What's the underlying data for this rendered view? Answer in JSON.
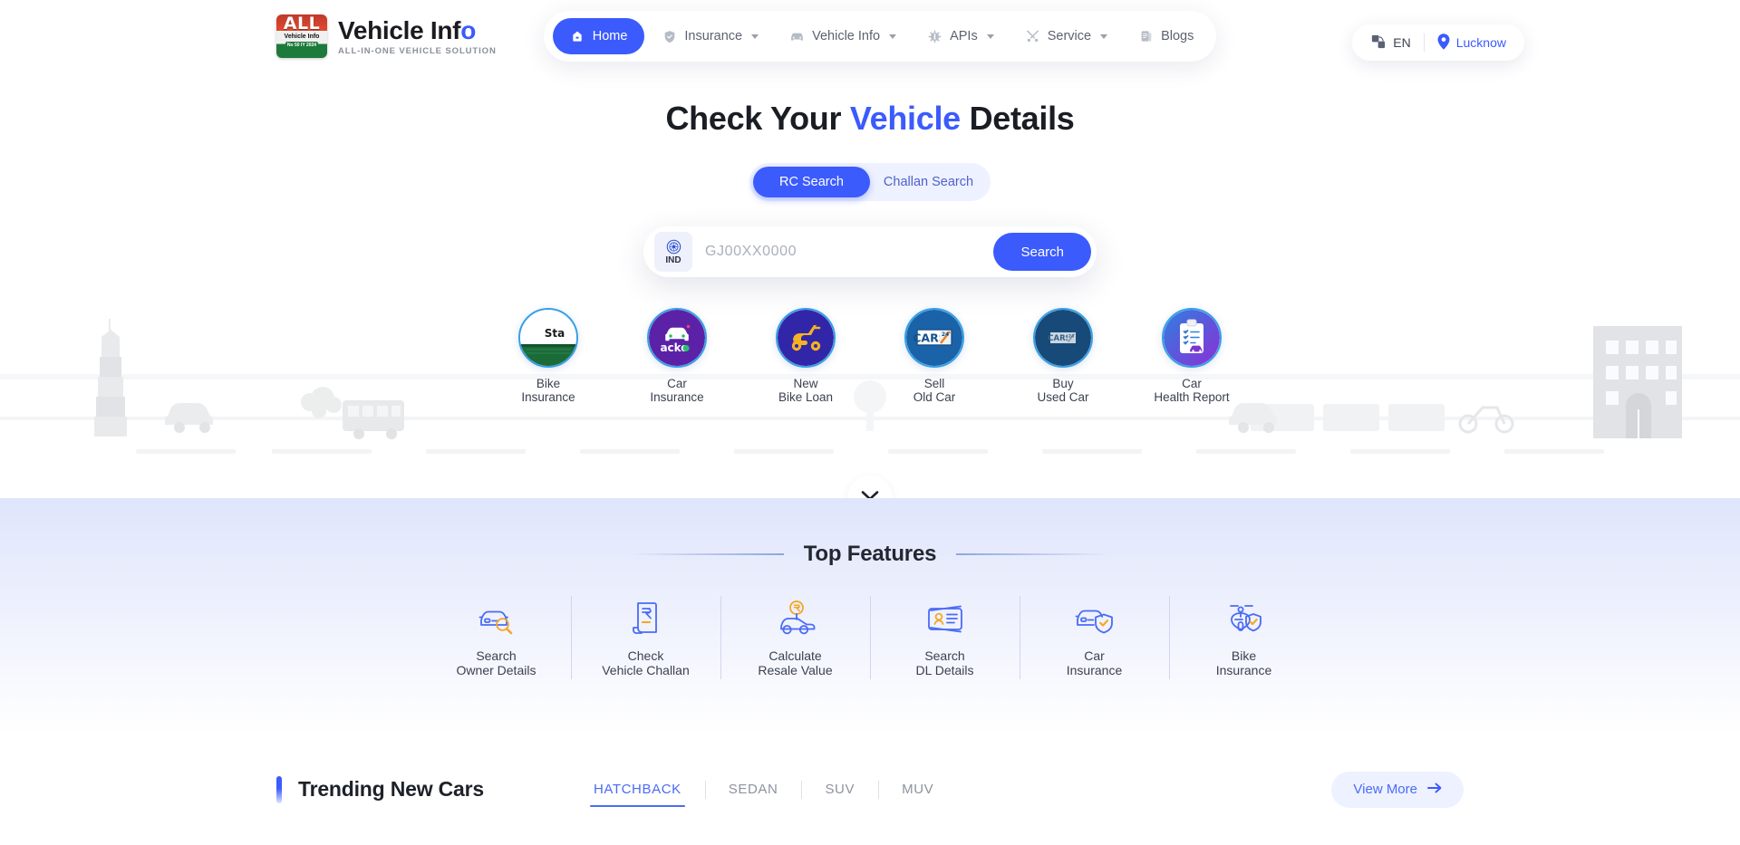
{
  "header": {
    "brand": {
      "logo_all": "ALL",
      "logo_sub": "Vehicle Info",
      "logo_badge": "No 50 IY 2024",
      "title_main": "Vehicle Inf",
      "title_accent": "o",
      "tagline": "ALL-IN-ONE VEHICLE SOLUTION"
    },
    "nav": [
      {
        "label": "Home",
        "icon": "home-icon",
        "active": true,
        "caret": false
      },
      {
        "label": "Insurance",
        "icon": "shield-icon",
        "active": false,
        "caret": true
      },
      {
        "label": "Vehicle Info",
        "icon": "car-icon",
        "active": false,
        "caret": true
      },
      {
        "label": "APIs",
        "icon": "api-chip-icon",
        "active": false,
        "caret": true
      },
      {
        "label": "Service",
        "icon": "tools-icon",
        "active": false,
        "caret": true
      },
      {
        "label": "Blogs",
        "icon": "document-icon",
        "active": false,
        "caret": false
      }
    ],
    "locale": {
      "language": "EN",
      "city": "Lucknow"
    }
  },
  "hero": {
    "title_part1": "Check Your ",
    "title_accent": "Vehicle",
    "title_part2": " Details",
    "tabs": [
      {
        "label": "RC Search",
        "active": true
      },
      {
        "label": "Challan Search",
        "active": false
      }
    ],
    "search": {
      "country_code": "IND",
      "placeholder": "GJ00XX0000",
      "value": "",
      "button_label": "Search"
    },
    "services": [
      {
        "label": "Bike\nInsurance",
        "icon": "star-health-logo",
        "ring": "#37a0e8"
      },
      {
        "label": "Car\nInsurance",
        "icon": "acko-logo",
        "ring": "#37a0e8"
      },
      {
        "label": "New\nBike Loan",
        "icon": "scooter-icon",
        "ring": "#37a0e8"
      },
      {
        "label": "Sell\nOld Car",
        "icon": "cars24-logo",
        "ring": "#37a0e8"
      },
      {
        "label": "Buy\nUsed Car",
        "icon": "cars24-logo-dark",
        "ring": "#37a0e8"
      },
      {
        "label": "Car\nHealth Report",
        "icon": "clipboard-car-icon",
        "ring": "#37a0e8"
      }
    ],
    "scroll_hint": "chevron-down-icon"
  },
  "features": {
    "title": "Top Features",
    "items": [
      {
        "label": "Search\nOwner Details",
        "icon": "car-search-icon"
      },
      {
        "label": "Check\nVehicle Challan",
        "icon": "rupee-receipt-icon"
      },
      {
        "label": "Calculate\nResale Value",
        "icon": "car-rupee-icon"
      },
      {
        "label": "Search\nDL Details",
        "icon": "id-card-icon"
      },
      {
        "label": "Car\nInsurance",
        "icon": "car-shield-icon"
      },
      {
        "label": "Bike\nInsurance",
        "icon": "bike-shield-icon"
      }
    ]
  },
  "trending": {
    "title": "Trending New Cars",
    "tabs": [
      {
        "label": "HATCHBACK",
        "active": true
      },
      {
        "label": "SEDAN",
        "active": false
      },
      {
        "label": "SUV",
        "active": false
      },
      {
        "label": "MUV",
        "active": false
      }
    ],
    "view_more": "View More"
  },
  "colors": {
    "brand_blue": "#3b5bfd",
    "accent_orange": "#f5a623",
    "ring_blue": "#37a0e8",
    "text_dark": "#1d2129",
    "text_muted": "#8d939e"
  }
}
